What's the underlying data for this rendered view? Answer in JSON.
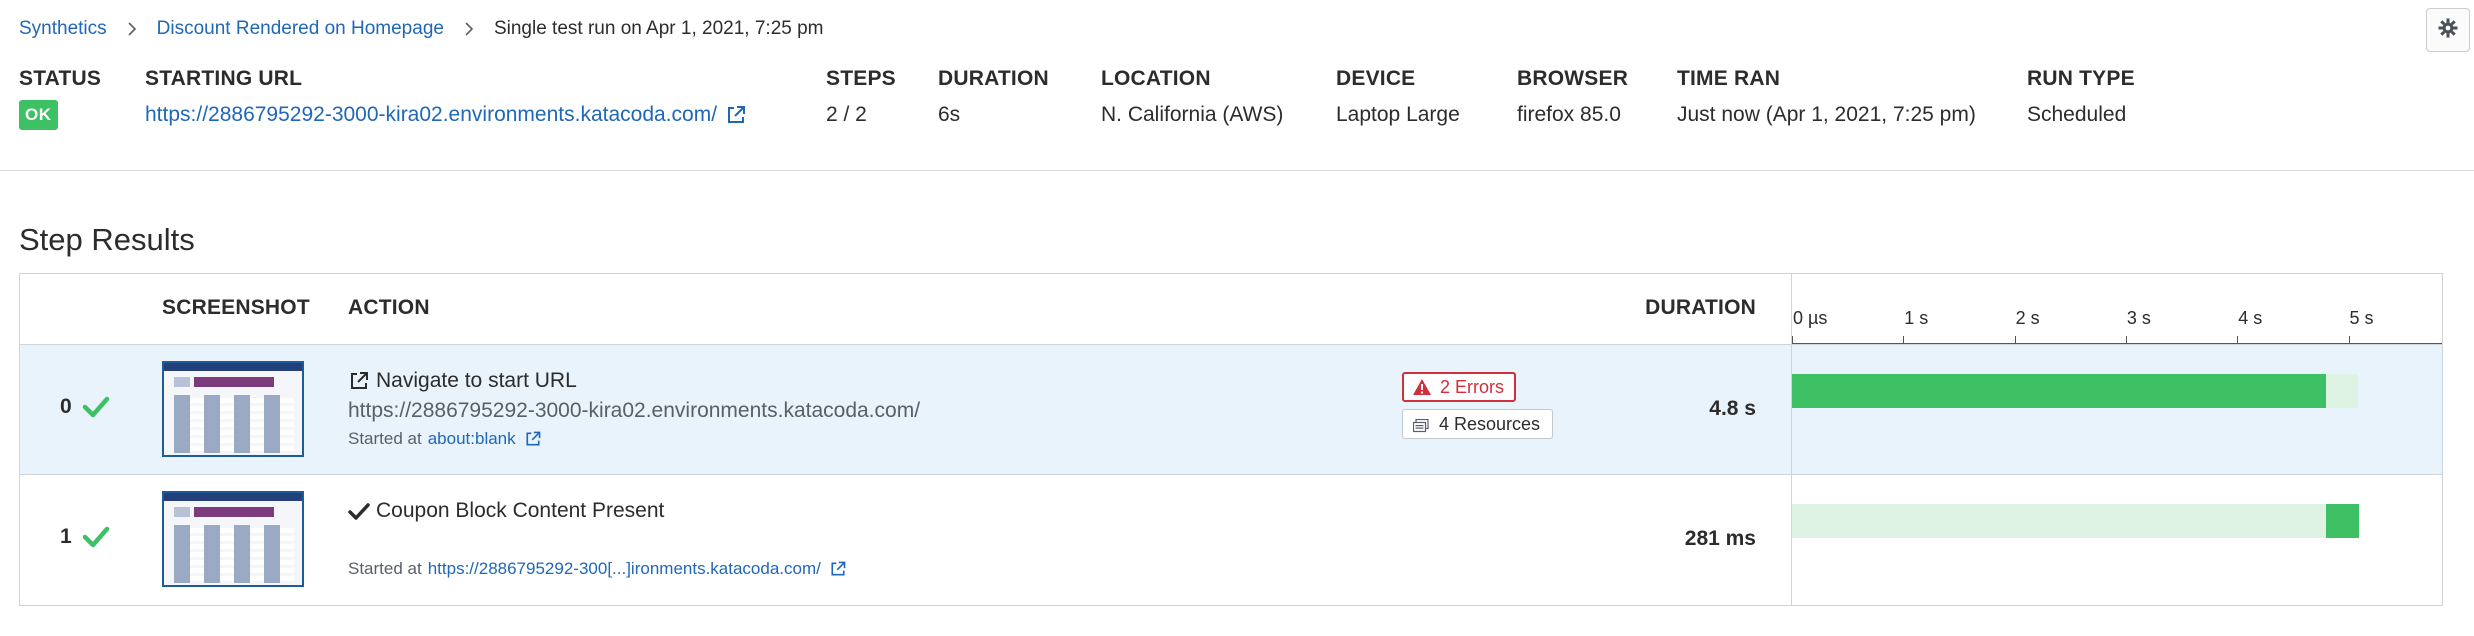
{
  "breadcrumb": {
    "items": [
      "Synthetics",
      "Discount Rendered on Homepage"
    ],
    "current": "Single test run on Apr 1, 2021, 7:25 pm"
  },
  "summary": {
    "status": {
      "label": "STATUS",
      "value": "OK"
    },
    "starting_url": {
      "label": "STARTING URL",
      "value": "https://2886795292-3000-kira02.environments.katacoda.com/"
    },
    "steps": {
      "label": "STEPS",
      "value": "2 / 2"
    },
    "duration": {
      "label": "DURATION",
      "value": "6s"
    },
    "location": {
      "label": "LOCATION",
      "value": "N. California (AWS)"
    },
    "device": {
      "label": "DEVICE",
      "value": "Laptop Large"
    },
    "browser": {
      "label": "BROWSER",
      "value": "firefox 85.0"
    },
    "time_ran": {
      "label": "TIME RAN",
      "value": "Just now (Apr 1, 2021, 7:25 pm)"
    },
    "run_type": {
      "label": "RUN TYPE",
      "value": "Scheduled"
    }
  },
  "step_results": {
    "title": "Step Results",
    "headers": {
      "screenshot": "SCREENSHOT",
      "action": "ACTION",
      "duration": "DURATION"
    },
    "timeline_ticks": [
      "0 µs",
      "1 s",
      "2 s",
      "3 s",
      "4 s",
      "5 s"
    ],
    "timeline_max_seconds": 5.5,
    "rows": [
      {
        "index": "0",
        "status": "passed",
        "action_icon": "external-link-icon",
        "action": "Navigate to start URL",
        "action_url": "https://2886795292-3000-kira02.environments.katacoda.com/",
        "started_label": "Started at",
        "started_url": "about:blank",
        "errors_badge": "2 Errors",
        "resources_badge": "4 Resources",
        "duration": "4.8 s",
        "start_seconds": 0,
        "duration_seconds": 4.8
      },
      {
        "index": "1",
        "status": "passed",
        "action_icon": "check-icon",
        "action": "Coupon Block Content Present",
        "started_label": "Started at",
        "started_url": "https://2886795292-300[...]ironments.katacoda.com/",
        "duration": "281 ms",
        "start_seconds": 4.8,
        "duration_seconds": 0.281
      }
    ]
  },
  "colors": {
    "link": "#1f67b7",
    "ok": "#3ec164",
    "error": "#d0303c",
    "row_highlight": "#e8f3fb",
    "timeline_track": "#dff3e5"
  }
}
